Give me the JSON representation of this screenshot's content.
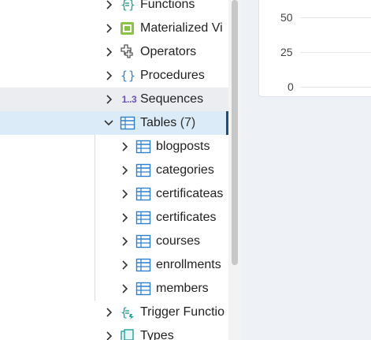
{
  "tree": {
    "items": [
      {
        "label": "Functions",
        "icon": "functions-icon"
      },
      {
        "label": "Materialized Vi",
        "icon": "materialized-view-icon"
      },
      {
        "label": "Operators",
        "icon": "operators-icon"
      },
      {
        "label": "Procedures",
        "icon": "procedures-icon"
      },
      {
        "label": "Sequences",
        "icon": "sequences-icon",
        "icon_text": "1..3"
      },
      {
        "label": "Tables",
        "count": "(7)",
        "icon": "tables-icon"
      },
      {
        "label": "Trigger Functio",
        "icon": "trigger-functions-icon"
      },
      {
        "label": "Types",
        "icon": "types-icon"
      }
    ],
    "tables": [
      "blogposts",
      "categories",
      "certificateas",
      "certificates",
      "courses",
      "enrollments",
      "members"
    ]
  },
  "chart": {
    "ticks": [
      "50",
      "25",
      "0"
    ]
  },
  "colors": {
    "selected_bg": "#dcebf8",
    "hover_bg": "#ebedf0",
    "accent": "#1f4f7a",
    "table_icon": "#2d7fd3"
  }
}
